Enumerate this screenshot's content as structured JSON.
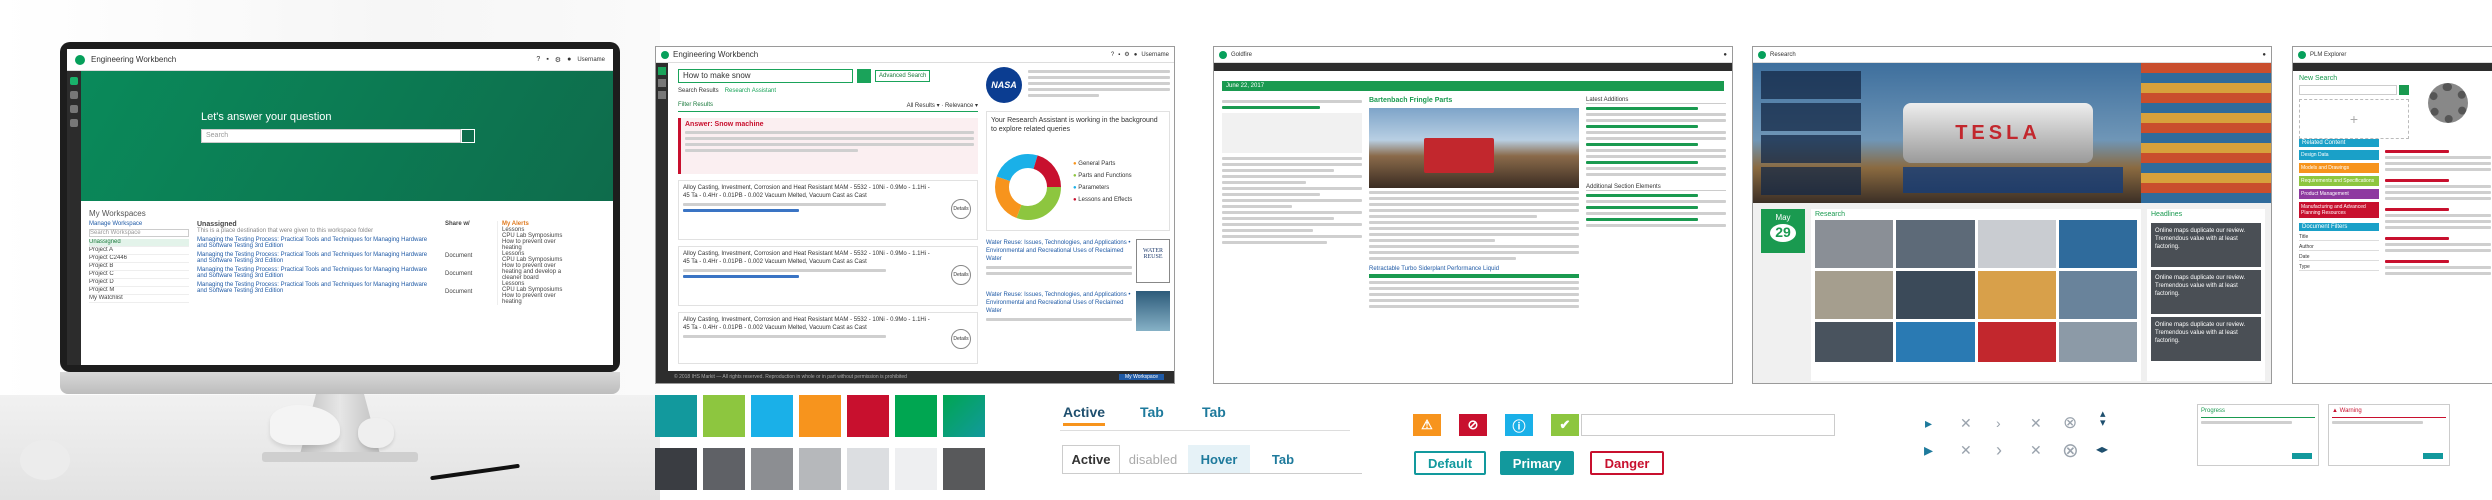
{
  "monitor": {
    "app_title": "Engineering Workbench",
    "user": "Username",
    "hero_title": "Let's answer your question",
    "search_placeholder": "Search",
    "workspaces_title": "My Workspaces",
    "manage_workspace": "Manage Workspace",
    "search_workspace": "Search Workspace",
    "workspace_items": [
      "Unassigned",
      "Project A",
      "Project C2446",
      "Project B",
      "Project C",
      "Project D",
      "Project M",
      "My Watchlist"
    ],
    "unassigned_title": "Unassigned",
    "unassigned_desc": "This is a place destination that were given to this workspace folder",
    "share_col": "Share w/",
    "document_label": "Document",
    "results": [
      "Managing the Testing Process: Practical Tools and Techniques for Managing Hardware and Software Testing 3rd Edition",
      "Managing the Testing Process: Practical Tools and Techniques for Managing Hardware and Software Testing 3rd Edition",
      "Managing the Testing Process: Practical Tools and Techniques for Managing Hardware and Software Testing 3rd Edition",
      "Managing the Testing Process: Practical Tools and Techniques for Managing Hardware and Software Testing 3rd Edition"
    ],
    "alerts_title": "My Alerts",
    "alerts": [
      "Lessons",
      "CPU Lab Symposiums",
      "How to prevent over heating",
      "Lessons",
      "CPU Lab Symposiums",
      "How to prevent over heating and develop a cleaner board",
      "Lessons",
      "CPU Lab Symposiums",
      "How to prevent over heating"
    ]
  },
  "shot2": {
    "app_title": "Engineering Workbench",
    "user": "Username",
    "query": "How to make snow",
    "advanced_search": "Advanced Search",
    "tab_results": "Search Results",
    "tab_assistant": "Research Assistant",
    "filter_results": "Filter Results",
    "all_results": "All Results",
    "relevance": "Relevance",
    "answer_title": "Answer: Snow machine",
    "nasa_label": "NASA",
    "assistant_title": "Your Research Assistant is working in the background to explore related queries",
    "legend": [
      "General Parts",
      "Parts and Functions",
      "Parameters",
      "Lessons and Effects"
    ],
    "result_titles": [
      "Alloy Casting, Investment, Corrosion and Heat Resistant MAM - 5532 - 10Ni - 0.9Mo - 1.1Hi - 45 Ta - 0.4Hr - 0.01PB - 0.002 Vacuum Melted, Vacuum Cast as Cast",
      "Alloy Casting, Investment, Corrosion and Heat Resistant MAM - 5532 - 10Ni - 0.9Mo - 1.1Hi - 45 Ta - 0.4Hr - 0.01PB - 0.002 Vacuum Melted, Vacuum Cast as Cast",
      "Alloy Casting, Investment, Corrosion and Heat Resistant MAM - 5532 - 10Ni - 0.9Mo - 1.1Hi - 45 Ta - 0.4Hr - 0.01PB - 0.002 Vacuum Melted, Vacuum Cast as Cast"
    ],
    "details": "Details",
    "book_title": "Water Reuse: Issues, Technologies, and Applications • Environmental and Recreational Uses of Reclaimed Water",
    "book_cover": "WATER REUSE",
    "footer": "© 2018 IHS Markit — All rights reserved. Reproduction in whole or in part without permission is prohibited",
    "workspace_btn": "My Workspace"
  },
  "shot3": {
    "app_title": "Goldfire",
    "section_title": "June 22, 2017",
    "article_title": "Bartenbach Fringle Parts",
    "table_title": "Retractable Turbo Siderplant Performance Liquid",
    "latest_additions": "Latest Additions",
    "additional_sections": "Additional Section Elements"
  },
  "shot4": {
    "app_title": "Research",
    "hero_brand": "TESLA",
    "date_month": "May",
    "date_day": "29",
    "research_label": "Research",
    "headlines_label": "Headlines",
    "news_cards": [
      "Online maps duplicate our review. Tremendous value with at least factoring.",
      "Online maps duplicate our review. Tremendous value with at least factoring.",
      "Online maps duplicate our review. Tremendous value with at least factoring."
    ]
  },
  "shot5": {
    "app_title": "PLM Explorer",
    "new_search": "New Search",
    "related_content": "Related Content",
    "related_items": [
      "Design Data",
      "Models and Drawings",
      "Requirements and Specifications",
      "Product Management",
      "Manufacturing and Advanced Planning Resources"
    ],
    "doc_filters": "Document Filters",
    "filters": [
      "Title",
      "Author",
      "Date",
      "Type"
    ]
  },
  "swatches": {
    "row1": [
      "#12999d",
      "#8dc63f",
      "#1ab0e8",
      "#f7941d",
      "#c8102e",
      "#00a651",
      "#18a558"
    ],
    "row2": [
      "#3a3d42",
      "#5f6166",
      "#8c8e92",
      "#b6b8bb",
      "#dcdee1",
      "#eeeff1",
      "#58595b"
    ]
  },
  "tabs": {
    "row1": [
      "Active",
      "Tab",
      "Tab"
    ],
    "row2": [
      "Active",
      "disabled",
      "Hover",
      "Tab"
    ]
  },
  "alerts": {
    "icons": [
      "warning-icon",
      "blocked-icon",
      "info-icon",
      "check-icon"
    ],
    "buttons": [
      "Default",
      "Primary",
      "Danger"
    ]
  },
  "dialogs": {
    "title1": "Progress",
    "title2": "Warning"
  }
}
